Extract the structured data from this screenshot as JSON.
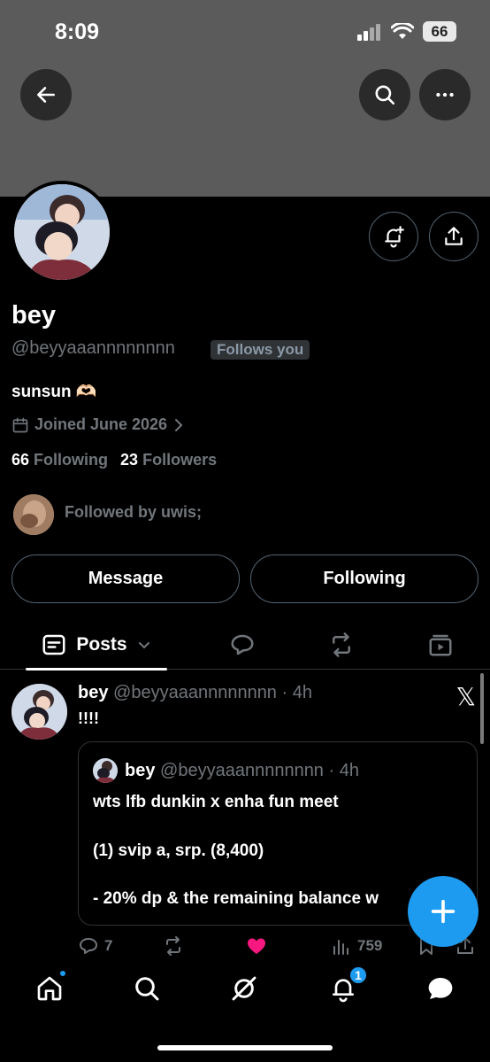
{
  "status_bar": {
    "time": "8:09",
    "battery": "66"
  },
  "profile": {
    "name": "bey",
    "handle": "@beyyaaannnnnnnn",
    "follows_you": "Follows you",
    "bio": "sunsun 🫶🏻",
    "joined": "Joined June 2026",
    "following_count": "66",
    "following_label": "Following",
    "followers_count": "23",
    "followers_label": "Followers",
    "followed_by": "Followed by uwis;"
  },
  "buttons": {
    "message": "Message",
    "following": "Following"
  },
  "tabs": {
    "posts": "Posts"
  },
  "post": {
    "name": "bey",
    "handle": "@beyyaaannnnnnnn · 4h",
    "text": "!!!!",
    "quote": {
      "name": "bey",
      "handle": "@beyyaaannnnnnnn · 4h",
      "line1": "wts lfb dunkin x enha fun meet",
      "line2": "(1) svip a, srp. (8,400)",
      "line3": "- 20% dp & the remaining balance w"
    },
    "replies": "7",
    "views": "759"
  },
  "nav": {
    "notifications_badge": "1"
  },
  "colors": {
    "accent": "#1d9bf0",
    "like": "#f91880",
    "banner": "#5b5b5b"
  }
}
